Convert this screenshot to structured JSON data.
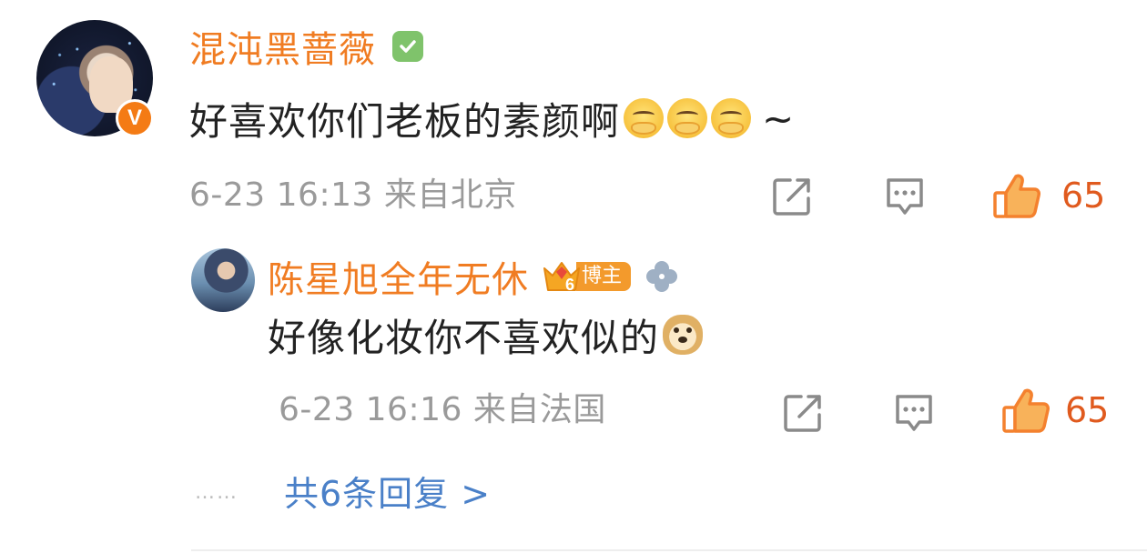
{
  "comment": {
    "username": "混沌黑蔷薇",
    "avatar_badge": "V",
    "text": "好喜欢你们老板的素颜啊",
    "emoji_names": [
      "crying-face-emoji",
      "crying-face-emoji",
      "crying-face-emoji"
    ],
    "text_suffix": "~",
    "timestamp": "6-23 16:13 来自北京",
    "like_count": "65"
  },
  "reply": {
    "username": "陈星旭全年无休",
    "fan_level": "6",
    "fan_badge_label": "博主",
    "text": "好像化妆你不喜欢似的",
    "emoji_name": "doge-emoji",
    "timestamp": "6-23 16:16 来自法国",
    "like_count": "65"
  },
  "more": {
    "dots": "……",
    "link_text": "共6条回复 >"
  },
  "colors": {
    "username": "#f07c22",
    "like": "#f58a3a",
    "link": "#4a80c8",
    "meta": "#9a9a9a"
  }
}
